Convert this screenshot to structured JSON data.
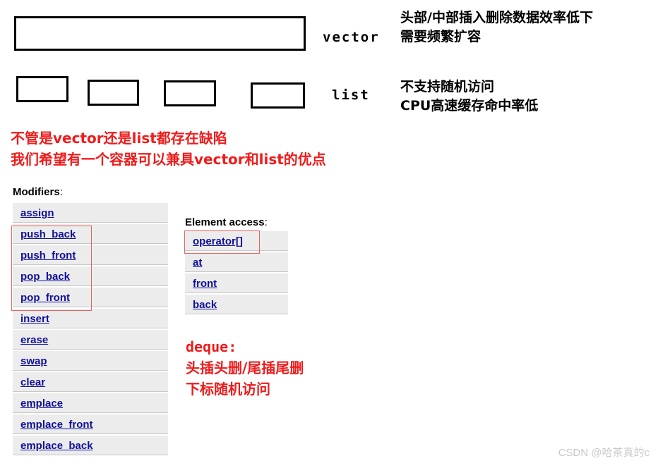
{
  "diagram": {
    "vector": {
      "container_name": "vector",
      "notes": [
        "头部/中部插入删除数据效率低下",
        "需要频繁扩容"
      ]
    },
    "list": {
      "container_name": "list",
      "node_count": 4,
      "notes": [
        "不支持随机访问",
        "CPU高速缓存命中率低"
      ]
    }
  },
  "problem_note": {
    "lines": [
      "不管是vector还是list都存在缺陷",
      "我们希望有一个容器可以兼具vector和list的优点"
    ],
    "color": "#f01b1b"
  },
  "reference": {
    "modifiers": {
      "heading_bold": "Modifiers",
      "heading_suffix": ":",
      "items": [
        "assign",
        "push_back",
        "push_front",
        "pop_back",
        "pop_front",
        "insert",
        "erase",
        "swap",
        "clear",
        "emplace",
        "emplace_front",
        "emplace_back"
      ],
      "highlighted_items": [
        "push_back",
        "push_front",
        "pop_back",
        "pop_front"
      ]
    },
    "element_access": {
      "heading_bold": "Element access",
      "heading_suffix": ":",
      "items": [
        "operator[]",
        "at",
        "front",
        "back"
      ],
      "highlighted_items": [
        "operator[]"
      ]
    },
    "link_color": "#101099",
    "row_background": "#ececec"
  },
  "deque_note": {
    "title": "deque:",
    "lines": [
      "头插头删/尾插尾删",
      "下标随机访问"
    ],
    "color": "#f01b1b"
  },
  "watermark": {
    "text": "CSDN @哈茶真的c"
  }
}
